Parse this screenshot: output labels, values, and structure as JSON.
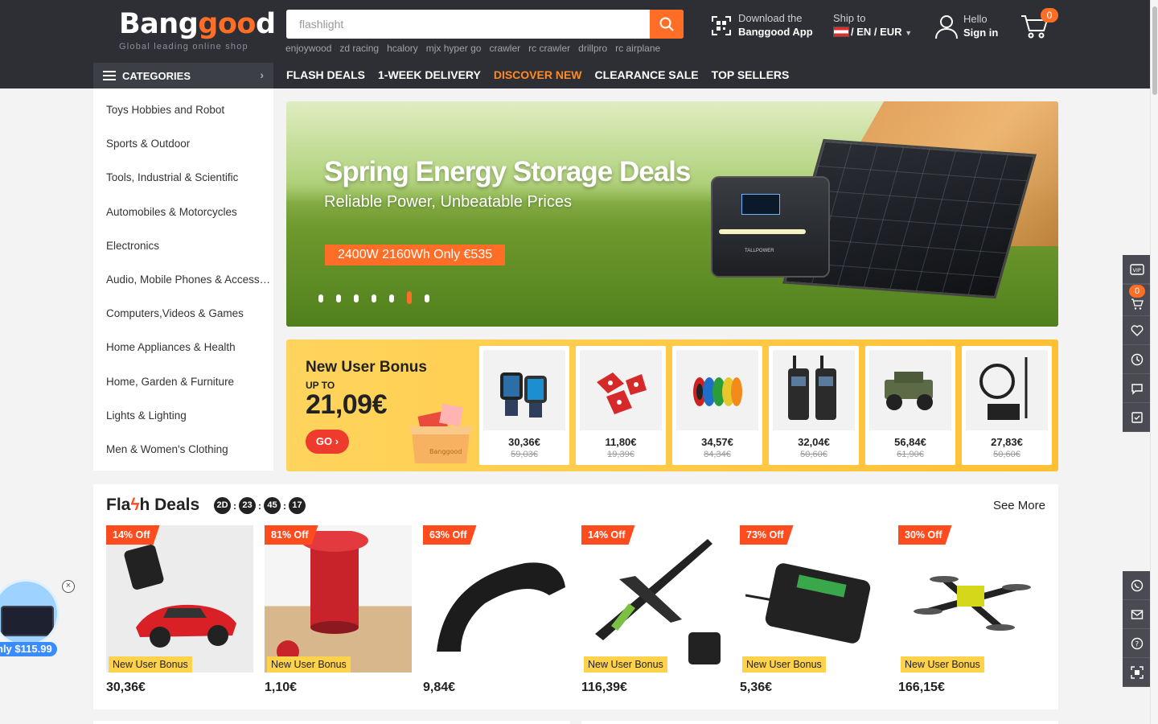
{
  "brand": {
    "logo_part1": "Bang",
    "logo_oo": "goo",
    "logo_part2": "d",
    "tagline": "Global leading online shop"
  },
  "search": {
    "placeholder": "flashlight",
    "hot_words": [
      "enjoywood",
      "zd racing",
      "hcalory",
      "mjx hyper go",
      "crawler",
      "rc crawler",
      "drillpro",
      "rc airplane"
    ]
  },
  "header": {
    "app_line1": "Download the",
    "app_line2": "Banggood App",
    "ship_label": "Ship to",
    "ship_value": "/ EN / EUR",
    "hello": "Hello",
    "sign_in": "Sign in",
    "cart_count": "0"
  },
  "nav": {
    "categories_label": "CATEGORIES",
    "items": [
      "FLASH DEALS",
      "1-WEEK DELIVERY",
      "DISCOVER NEW",
      "CLEARANCE SALE",
      "TOP SELLERS"
    ]
  },
  "categories": [
    "Toys Hobbies and Robot",
    "Sports & Outdoor",
    "Tools, Industrial & Scientific",
    "Automobiles & Motorcycles",
    "Electronics",
    "Audio, Mobile Phones & Accessories",
    "Computers,Videos & Games",
    "Home Appliances & Health",
    "Home, Garden & Furniture",
    "Lights & Lighting",
    "Men & Women's Clothing"
  ],
  "banner": {
    "title": "Spring Energy Storage Deals",
    "subtitle": "Reliable Power, Unbeatable Prices",
    "promo": "2400W 2160Wh Only €535",
    "device_brand": "TALLPOWER",
    "slide_count": 7,
    "active_slide": 5
  },
  "bonus": {
    "title": "New User Bonus",
    "upto": "UP TO",
    "amount": "21,09€",
    "go": "GO",
    "box_label": "Banggood",
    "products": [
      {
        "price": "30,36€",
        "old": "59,03€",
        "icon": "smartwatch-icon"
      },
      {
        "price": "11,80€",
        "old": "19,39€",
        "icon": "red-clamp-icon"
      },
      {
        "price": "34,57€",
        "old": "84,34€",
        "icon": "filament-spools-icon"
      },
      {
        "price": "32,04€",
        "old": "50,60€",
        "icon": "walkie-talkie-icon"
      },
      {
        "price": "56,84€",
        "old": "61,90€",
        "icon": "rc-jeep-icon"
      },
      {
        "price": "27,83€",
        "old": "50,60€",
        "icon": "antenna-kit-icon"
      }
    ]
  },
  "flash": {
    "title_pre": "Fla",
    "title_bolt": "ϟ",
    "title_post": "h Deals",
    "timer": [
      "2D",
      "23",
      "45",
      "17"
    ],
    "see_more": "See More",
    "badge": "New User Bonus",
    "deals": [
      {
        "off": "14% Off",
        "price": "30,36€",
        "icon": "rc-car-icon"
      },
      {
        "off": "81% Off",
        "price": "1,10€",
        "icon": "red-peg-icon"
      },
      {
        "off": "63% Off",
        "price": "9,84€",
        "icon": "fender-icon",
        "badge": ""
      },
      {
        "off": "14% Off",
        "price": "116,39€",
        "icon": "rc-plane-icon"
      },
      {
        "off": "73% Off",
        "price": "5,36€",
        "icon": "rc-receiver-icon"
      },
      {
        "off": "30% Off",
        "price": "166,15€",
        "icon": "fpv-drone-icon"
      }
    ]
  },
  "float_ad": {
    "label": "nly $115.99"
  },
  "sidebar": {
    "cart_count": "0",
    "vip": "VIP"
  },
  "colors": {
    "header_bg": "#2e2f35",
    "accent": "#ff6e26",
    "nav_active": "#ff8a24",
    "discount": "#ff4c1f",
    "bonus_bg": "#ffc032"
  }
}
